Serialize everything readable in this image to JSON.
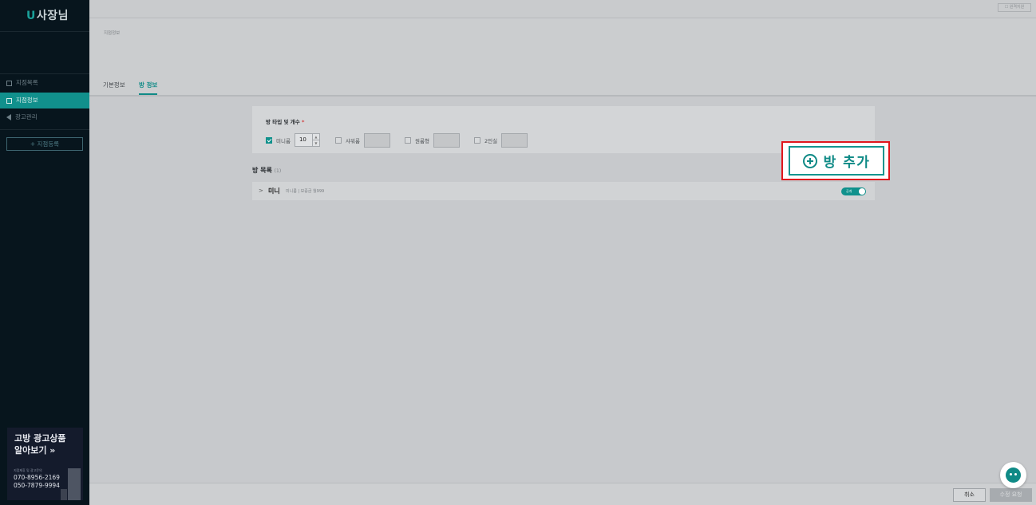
{
  "sidebar": {
    "logo_letter": "U",
    "logo_text": "사장님",
    "items": [
      {
        "label": "지점목록"
      },
      {
        "label": "지점정보"
      },
      {
        "label": "광고관리"
      }
    ],
    "add_branch": "+ 지점등록",
    "promo": {
      "title": "고방 광고상품\n알아보기 »",
      "contact_caption": "지점제휴 및 광고문의",
      "phone1": "070-8956-2169",
      "phone2": "050-7879-9994"
    }
  },
  "topbar": {
    "help_label": "☐ 원격지원"
  },
  "header": {
    "breadcrumb": "지점정보",
    "tabs": [
      {
        "label": "기본정보"
      },
      {
        "label": "방 정보"
      }
    ]
  },
  "room_type": {
    "label": "방 타입 및 개수",
    "required_mark": "*",
    "options": [
      {
        "label": "미니룸",
        "checked": true,
        "count": "10"
      },
      {
        "label": "샤워룸",
        "checked": false
      },
      {
        "label": "원룸형",
        "checked": false
      },
      {
        "label": "2인실",
        "checked": false
      }
    ]
  },
  "add_room_button": "방 추가",
  "room_list": {
    "title": "방 목록",
    "count": "(1)",
    "rows": [
      {
        "name": "미니",
        "meta": "미니룸 | 보증금 월999",
        "toggle": "공개",
        "toggle_on": true
      }
    ]
  },
  "footer": {
    "cancel_label": "취소",
    "save_label": "수정 요청"
  },
  "colors": {
    "accent": "#10918c",
    "highlight": "#e0161c"
  }
}
